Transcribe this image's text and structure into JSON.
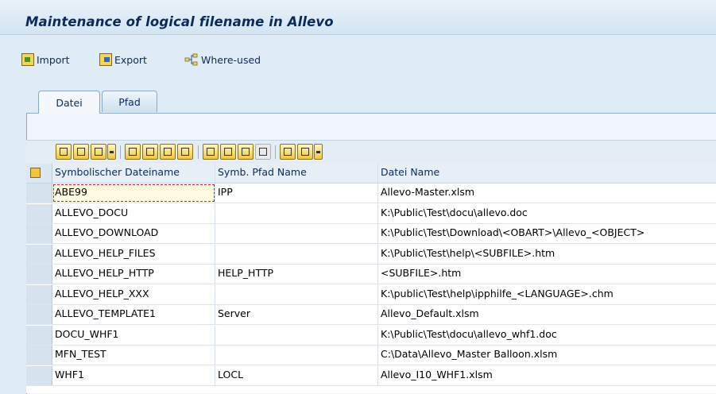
{
  "window": {
    "title": "Maintenance of logical filename in Allevo"
  },
  "toolbar": {
    "import_label": "Import",
    "export_label": "Export",
    "whereused_label": "Where-used"
  },
  "tabs": [
    {
      "label": "Datei",
      "active": true
    },
    {
      "label": "Pfad",
      "active": false
    }
  ],
  "grid": {
    "columns": [
      "Symbolischer Dateiname",
      "Symb. Pfad Name",
      "Datei Name"
    ],
    "rows": [
      {
        "name": "ABE99",
        "path": "IPP",
        "file": "Allevo-Master.xlsm"
      },
      {
        "name": "ALLEVO_DOCU",
        "path": "",
        "file": "K:\\Public\\Test\\docu\\allevo.doc"
      },
      {
        "name": "ALLEVO_DOWNLOAD",
        "path": "",
        "file": "K:\\Public\\Test\\Download\\<OBART>\\Allevo_<OBJECT>"
      },
      {
        "name": "ALLEVO_HELP_FILES",
        "path": "",
        "file": "K:\\Public\\Test\\help\\<SUBFILE>.htm"
      },
      {
        "name": "ALLEVO_HELP_HTTP",
        "path": "HELP_HTTP",
        "file": "<SUBFILE>.htm"
      },
      {
        "name": "ALLEVO_HELP_XXX",
        "path": "",
        "file": "K:\\public\\Test\\help\\ipphilfe_<LANGUAGE>.chm"
      },
      {
        "name": "ALLEVO_TEMPLATE1",
        "path": "Server",
        "file": "Allevo_Default.xlsm"
      },
      {
        "name": "DOCU_WHF1",
        "path": "",
        "file": "K:\\Public\\Test\\docu\\allevo_whf1.doc"
      },
      {
        "name": "MFN_TEST",
        "path": "",
        "file": "C:\\Data\\Allevo_Master Balloon.xlsm"
      },
      {
        "name": "WHF1",
        "path": "LOCL",
        "file": "Allevo_I10_WHF1.xlsm"
      }
    ]
  },
  "colors": {
    "background": "#dfebf5",
    "title": "#0a2a5a",
    "active_cell_border": "#d2232a"
  }
}
